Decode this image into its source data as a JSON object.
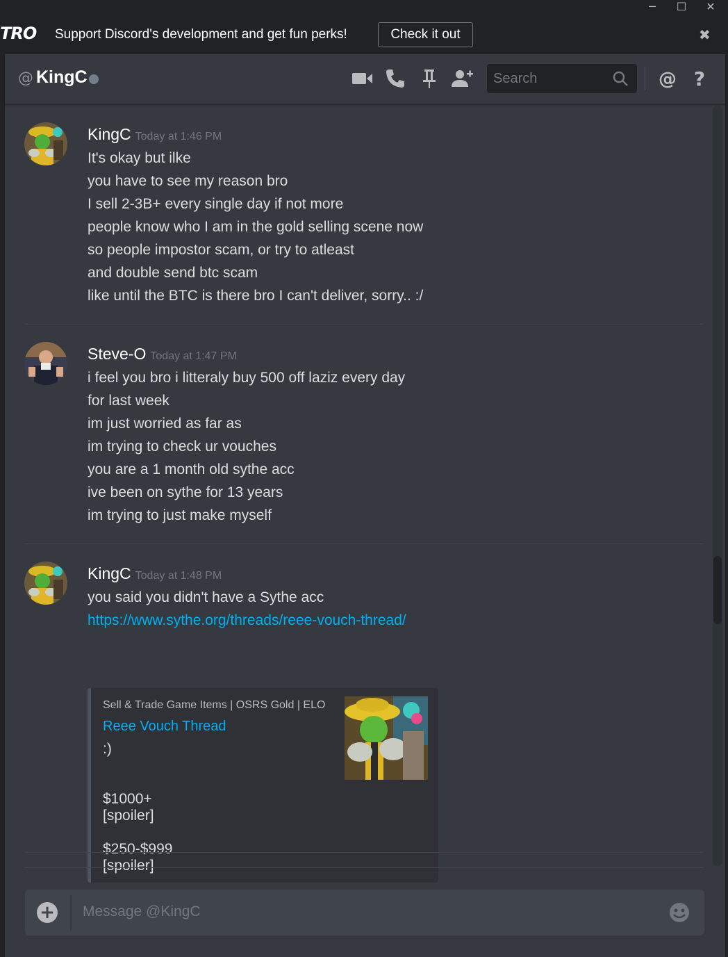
{
  "window": {
    "minimize": "─",
    "maximize": "☐",
    "close": "✕"
  },
  "banner": {
    "logo": "TRO",
    "text": "Support Discord's development and get fun perks!",
    "button": "Check it out",
    "close": "✖"
  },
  "header": {
    "at_symbol": "@",
    "channel_name": "KingC",
    "search_placeholder": "Search",
    "icons": [
      "video-icon",
      "phone-icon",
      "pin-icon",
      "add-friend-icon",
      "mention-icon",
      "help-icon"
    ]
  },
  "messages": [
    {
      "author": "KingC",
      "timestamp": "Today at 1:46 PM",
      "lines": [
        "It's okay but ilke",
        "you have to see my reason bro",
        "I sell 2-3B+ every single day if not more",
        "people know who I am in the gold selling scene now",
        "so people impostor scam, or try to atleast",
        "and double send btc scam",
        "like until the BTC is there bro I can't deliver, sorry.. :/"
      ]
    },
    {
      "author": "Steve-O",
      "timestamp": "Today at 1:47 PM",
      "lines": [
        "i feel you bro i litteraly buy 500 off laziz every day",
        "for last week",
        "im just worried as far as",
        "im trying to check ur vouches",
        "you are a 1 month old sythe acc",
        "ive been on sythe for 13 years",
        "im trying to just make myself"
      ]
    },
    {
      "author": "KingC",
      "timestamp": "Today at 1:48 PM",
      "lines": [
        "you said you didn't have a Sythe acc"
      ],
      "link": "https://www.sythe.org/threads/reee-vouch-thread/",
      "embed": {
        "provider": "Sell & Trade Game Items | OSRS Gold | ELO",
        "title": "Reee Vouch Thread",
        "description": ":)",
        "body": [
          "$1000+",
          "[spoiler]",
          "$250-$999",
          "[spoiler]"
        ]
      }
    }
  ],
  "input": {
    "placeholder": "Message @KingC",
    "plus": "+"
  },
  "colors": {
    "accent_link": "#00b0f4",
    "background": "#36393f",
    "status_offline": "#747f8d"
  }
}
